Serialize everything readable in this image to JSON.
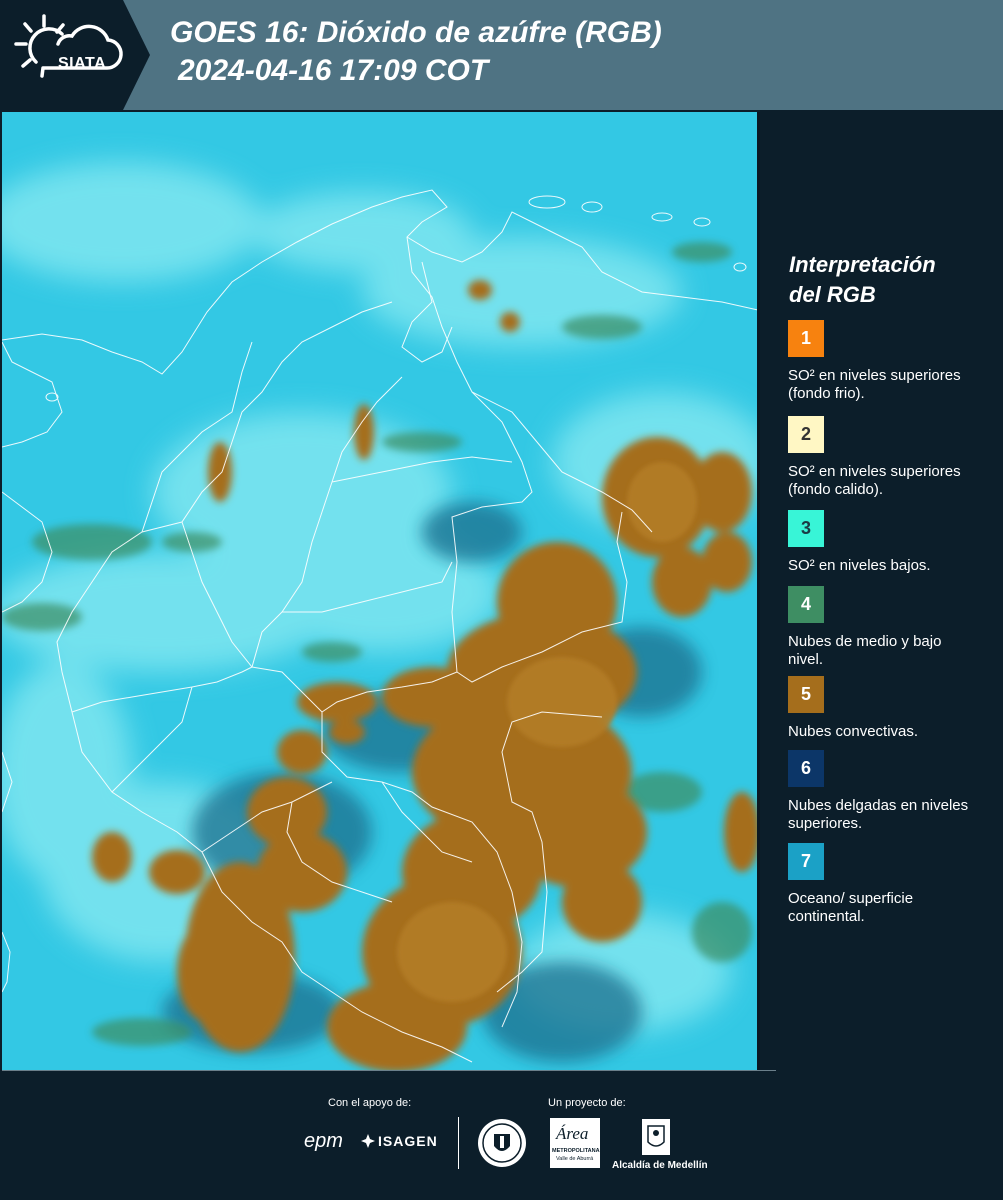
{
  "header": {
    "logo_text": "SIATA",
    "title_line1": "GOES 16: Dióxido de azúfre (RGB)",
    "title_line2": "2024-04-16 17:09 COT"
  },
  "legend": {
    "title_line1": "Interpretación",
    "title_line2": "del RGB",
    "items": [
      {
        "number": "1",
        "color": "#f7820f",
        "text_color": "#ffffff",
        "label": "SO² en niveles superiores (fondo frio)."
      },
      {
        "number": "2",
        "color": "#fff7c4",
        "text_color": "#333333",
        "label": "SO² en niveles superiores (fondo calido)."
      },
      {
        "number": "3",
        "color": "#38f5d7",
        "text_color": "#1b3b44",
        "label": "SO² en niveles bajos."
      },
      {
        "number": "4",
        "color": "#3e8e63",
        "text_color": "#ffffff",
        "label": "Nubes de medio y bajo nivel."
      },
      {
        "number": "5",
        "color": "#a56e1c",
        "text_color": "#ffffff",
        "label": "Nubes convectivas."
      },
      {
        "number": "6",
        "color": "#0c3668",
        "text_color": "#ffffff",
        "label": "Nubes delgadas en niveles superiores."
      },
      {
        "number": "7",
        "color": "#1ba1c6",
        "text_color": "#ffffff",
        "label": "Oceano/ superficie continental."
      }
    ]
  },
  "footer": {
    "support_label": "Con el apoyo de:",
    "project_label": "Un proyecto de:",
    "sponsor_epm": "epm",
    "sponsor_isagen": "ISAGEN",
    "partner_area_1": "Área",
    "partner_area_2": "METROPOLITANA",
    "partner_area_3": "Valle de Aburrá",
    "partner_alcaldia": "Alcaldía de Medellín"
  },
  "colors": {
    "background": "#0c1e2a",
    "header_band": "#4f7383",
    "ocean": "#34c9e4",
    "convective": "#a56e1c",
    "low_cloud": "#3e8e63"
  }
}
